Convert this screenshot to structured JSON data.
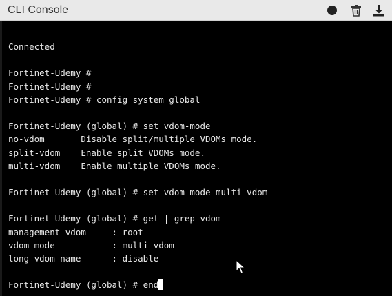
{
  "window": {
    "title": "CLI Console"
  },
  "toolbar": {
    "icons": [
      "record-icon",
      "trash-icon",
      "download-icon"
    ]
  },
  "terminal": {
    "lines": [
      "Connected",
      "",
      "Fortinet-Udemy #",
      "Fortinet-Udemy #",
      "Fortinet-Udemy # config system global",
      "",
      "Fortinet-Udemy (global) # set vdom-mode",
      "no-vdom       Disable split/multiple VDOMs mode.",
      "split-vdom    Enable split VDOMs mode.",
      "multi-vdom    Enable multiple VDOMs mode.",
      "",
      "Fortinet-Udemy (global) # set vdom-mode multi-vdom",
      "",
      "Fortinet-Udemy (global) # get | grep vdom",
      "management-vdom     : root",
      "vdom-mode           : multi-vdom",
      "long-vdom-name      : disable",
      "",
      "Fortinet-Udemy (global) # end"
    ]
  }
}
